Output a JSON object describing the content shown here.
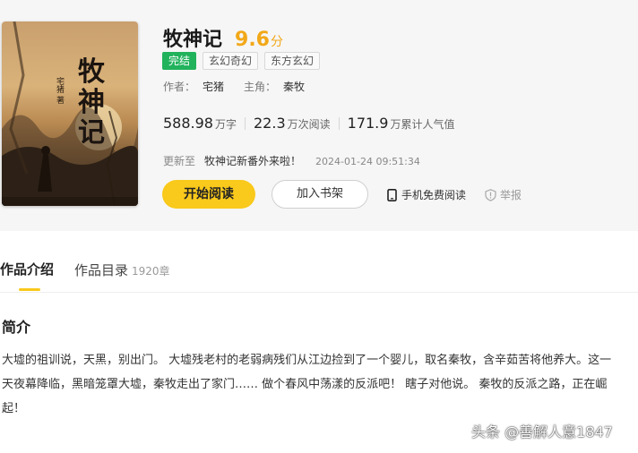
{
  "book": {
    "title": "牧神记",
    "score": "9.6",
    "score_unit": "分",
    "status_tag": "完结",
    "genre_tags": [
      "玄幻奇幻",
      "东方玄幻"
    ],
    "author_label": "作者：",
    "author": "宅猪",
    "protagonist_label": "主角：",
    "protagonist": "秦牧",
    "cover": {
      "title_text": "牧神记",
      "author_text": "宅猪 著"
    }
  },
  "stats": [
    {
      "value": "588.98",
      "unit": "万字"
    },
    {
      "value": "22.3",
      "unit": "万次阅读"
    },
    {
      "value": "171.9",
      "unit": "万累计人气值"
    }
  ],
  "update": {
    "label": "更新至",
    "chapter": "牧神记新番外来啦！",
    "time": "2024-01-24 09:51:34"
  },
  "actions": {
    "read_label": "开始阅读",
    "shelf_label": "加入书架",
    "mobile_label": "手机免费阅读",
    "report_label": "举报"
  },
  "tabs": {
    "intro_label": "作品介绍",
    "catalog_label": "作品目录",
    "catalog_count": "1920章"
  },
  "intro": {
    "heading": "简介",
    "text": "大墟的祖训说，天黑，别出门。 大墟残老村的老弱病残们从江边捡到了一个婴儿，取名秦牧，含辛茹苦将他养大。这一天夜幕降临，黑暗笼罩大墟，秦牧走出了家门…… 做个春风中荡漾的反派吧！ 瞎子对他说。 秦牧的反派之路，正在崛起！"
  },
  "watermark": "头条 @善解人意1847",
  "colors": {
    "accent": "#f9c91b",
    "score": "#f2a818",
    "status_tag": "#21b25c"
  },
  "icons": {
    "mobile": "phone-icon",
    "report": "warning-shield-icon"
  }
}
